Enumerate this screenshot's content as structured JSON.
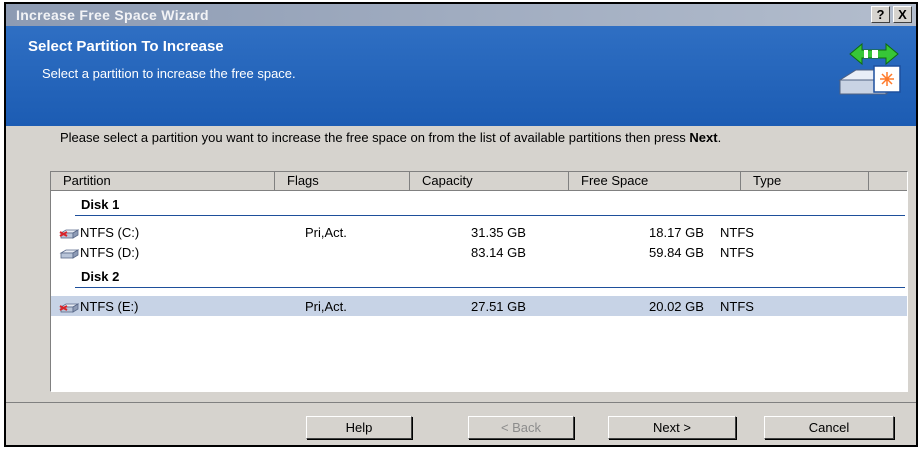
{
  "window": {
    "title": "Increase Free Space Wizard",
    "help_glyph": "?",
    "close_glyph": "X"
  },
  "header": {
    "title": "Select Partition To Increase",
    "subtitle": "Select a partition to increase the free space."
  },
  "instructions": {
    "text_before": "Please select a partition you want to increase the free space on from the list of available partitions then press ",
    "bold_word": "Next",
    "text_after": "."
  },
  "columns": [
    "Partition",
    "Flags",
    "Capacity",
    "Free Space",
    "Type"
  ],
  "groups": [
    {
      "label": "Disk 1",
      "partitions": [
        {
          "name": "NTFS (C:)",
          "flags": "Pri,Act.",
          "capacity": "31.35 GB",
          "free_space": "18.17 GB",
          "type": "NTFS",
          "selected": false,
          "icon": "partition-drive-red-icon"
        },
        {
          "name": "NTFS (D:)",
          "flags": "",
          "capacity": "83.14 GB",
          "free_space": "59.84 GB",
          "type": "NTFS",
          "selected": false,
          "icon": "partition-drive-icon"
        }
      ]
    },
    {
      "label": "Disk 2",
      "partitions": [
        {
          "name": "NTFS (E:)",
          "flags": "Pri,Act.",
          "capacity": "27.51 GB",
          "free_space": "20.02 GB",
          "type": "NTFS",
          "selected": true,
          "icon": "partition-drive-red-icon"
        }
      ]
    }
  ],
  "buttons": {
    "help": "Help",
    "back": "< Back",
    "next": "Next >",
    "cancel": "Cancel"
  },
  "colors": {
    "header_bg": "#2462b9",
    "selection": "#c7d3e6",
    "dialog_face": "#d6d3ce"
  }
}
